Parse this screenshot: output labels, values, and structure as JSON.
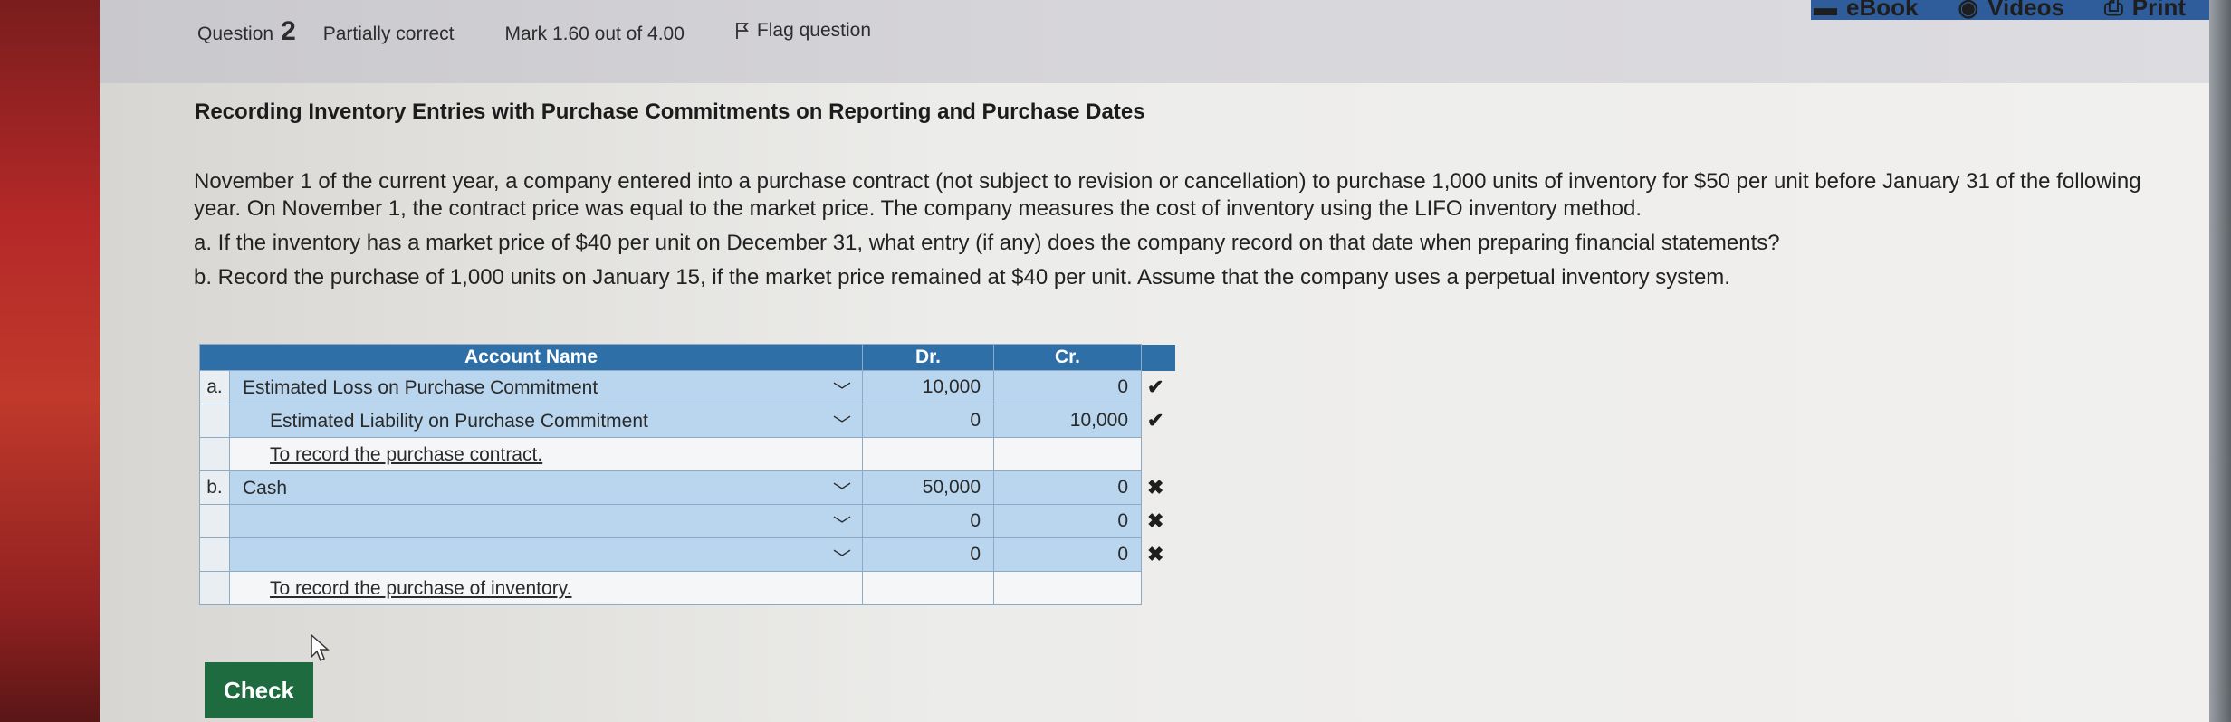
{
  "header": {
    "links": [
      {
        "icon": "ebook-icon",
        "label": "eBook"
      },
      {
        "icon": "play-circle-icon",
        "label": "Videos"
      },
      {
        "icon": "printer-icon",
        "label": "Print"
      }
    ],
    "question_label": "Question",
    "question_number": "2",
    "status": "Partially correct",
    "mark": "Mark 1.60 out of 4.00",
    "flag": "Flag question"
  },
  "problem": {
    "title": "Recording Inventory Entries with Purchase Commitments on Reporting and Purchase Dates",
    "intro": "November 1 of the current year, a company entered into a purchase contract (not subject to revision or cancellation) to purchase 1,000 units of inventory for $50 per unit before January 31 of the following year. On November 1, the contract price was equal to the market price. The company measures the cost of inventory using the LIFO inventory method.",
    "part_a": "a. If the inventory has a market price of $40 per unit on December 31, what entry (if any) does the company record on that date when preparing financial statements?",
    "part_b": "b. Record the purchase of 1,000 units on January 15, if the market price remained at $40 per unit. Assume that the company uses a perpetual inventory system."
  },
  "table": {
    "headers": {
      "account": "Account Name",
      "dr": "Dr.",
      "cr": "Cr."
    },
    "rows": [
      {
        "label": "a.",
        "account": "Estimated Loss on Purchase Commitment",
        "dr": "10,000",
        "cr": "0",
        "mark": "✔"
      },
      {
        "label": "",
        "account": "Estimated Liability on Purchase Commitment",
        "dr": "0",
        "cr": "10,000",
        "mark": "✔"
      },
      {
        "label": "",
        "memo": "To record the purchase contract."
      },
      {
        "label": "b.",
        "account": "Cash",
        "dr": "50,000",
        "cr": "0",
        "mark": "✖"
      },
      {
        "label": "",
        "account": "",
        "dr": "0",
        "cr": "0",
        "mark": "✖"
      },
      {
        "label": "",
        "account": "",
        "dr": "0",
        "cr": "0",
        "mark": "✖"
      },
      {
        "label": "",
        "memo": "To record the purchase of inventory."
      }
    ]
  },
  "check_button": "Check"
}
